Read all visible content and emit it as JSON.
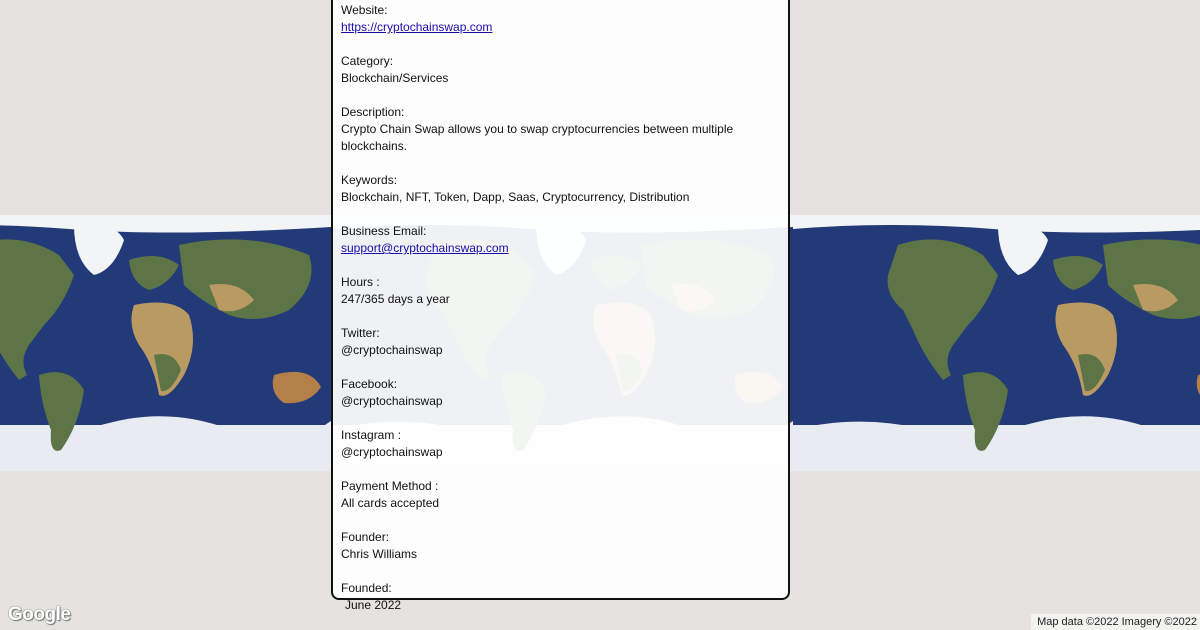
{
  "panel": {
    "fields": [
      {
        "label": "Website:",
        "value": "https://cryptochainswap.com",
        "link": true
      },
      {
        "label": "Category:",
        "value": "Blockchain/Services"
      },
      {
        "label": "Description:",
        "value": "Crypto Chain Swap allows you to swap cryptocurrencies between multiple blockchains."
      },
      {
        "label": "Keywords:",
        "value": "Blockchain, NFT, Token, Dapp, Saas, Cryptocurrency, Distribution"
      },
      {
        "label": "Business Email:",
        "value": "support@cryptochainswap.com",
        "link": true
      },
      {
        "label": "Hours :",
        "value": "247/365 days a year"
      },
      {
        "label": "Twitter:",
        "value": "@cryptochainswap"
      },
      {
        "label": "Facebook:",
        "value": "@cryptochainswap"
      },
      {
        "label": "Instagram :",
        "value": "@cryptochainswap"
      },
      {
        "label": "Payment Method :",
        "value": "All cards accepted"
      },
      {
        "label": "Founder:",
        "value": "Chris Williams"
      },
      {
        "label": "Founded:",
        "value": "June 2022"
      }
    ]
  },
  "map": {
    "logo": "Google",
    "attribution": "Map data ©2022 Imagery ©2022",
    "ocean_color": "#223a78",
    "land_color": "#5d7446",
    "ice_color": "#e8ecf2"
  }
}
